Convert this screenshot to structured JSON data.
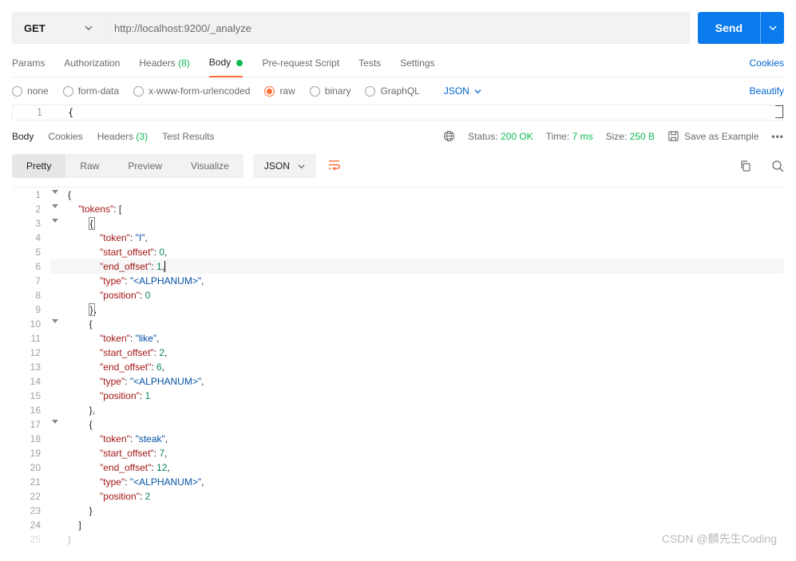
{
  "request": {
    "method": "GET",
    "url": "http://localhost:9200/_analyze",
    "sendLabel": "Send"
  },
  "reqTabs": {
    "params": "Params",
    "authorization": "Authorization",
    "headers": "Headers",
    "headersCount": "(8)",
    "body": "Body",
    "prerequest": "Pre-request Script",
    "tests": "Tests",
    "settings": "Settings",
    "cookies": "Cookies"
  },
  "bodyTypes": {
    "none": "none",
    "formdata": "form-data",
    "xwww": "x-www-form-urlencoded",
    "raw": "raw",
    "binary": "binary",
    "graphql": "GraphQL",
    "jsonLabel": "JSON",
    "beautify": "Beautify"
  },
  "inputEditor": {
    "line1": "1",
    "content": "{"
  },
  "respTabs": {
    "body": "Body",
    "cookies": "Cookies",
    "headers": "Headers",
    "headersCount": "(3)",
    "testresults": "Test Results"
  },
  "respMeta": {
    "statusLabel": "Status:",
    "statusVal": "200 OK",
    "timeLabel": "Time:",
    "timeVal": "7 ms",
    "sizeLabel": "Size:",
    "sizeVal": "250 B",
    "saveExample": "Save as Example"
  },
  "viewerSeg": {
    "pretty": "Pretty",
    "raw": "Raw",
    "preview": "Preview",
    "visualize": "Visualize",
    "json": "JSON"
  },
  "jsonLines": [
    {
      "n": 1,
      "indent": 0,
      "parts": [
        {
          "t": "punc",
          "v": "{"
        }
      ],
      "fold": true
    },
    {
      "n": 2,
      "indent": 1,
      "parts": [
        {
          "t": "key",
          "v": "\"tokens\""
        },
        {
          "t": "punc",
          "v": ": ["
        }
      ],
      "fold": true
    },
    {
      "n": 3,
      "indent": 2,
      "parts": [
        {
          "t": "box",
          "v": "{"
        }
      ],
      "fold": true
    },
    {
      "n": 4,
      "indent": 3,
      "parts": [
        {
          "t": "key",
          "v": "\"token\""
        },
        {
          "t": "punc",
          "v": ": "
        },
        {
          "t": "str",
          "v": "\"I\""
        },
        {
          "t": "punc",
          "v": ","
        }
      ]
    },
    {
      "n": 5,
      "indent": 3,
      "parts": [
        {
          "t": "key",
          "v": "\"start_offset\""
        },
        {
          "t": "punc",
          "v": ": "
        },
        {
          "t": "num",
          "v": "0"
        },
        {
          "t": "punc",
          "v": ","
        }
      ]
    },
    {
      "n": 6,
      "indent": 3,
      "parts": [
        {
          "t": "key",
          "v": "\"end_offset\""
        },
        {
          "t": "punc",
          "v": ": "
        },
        {
          "t": "num",
          "v": "1"
        },
        {
          "t": "punc",
          "v": ","
        }
      ],
      "highlight": true,
      "cursor": true
    },
    {
      "n": 7,
      "indent": 3,
      "parts": [
        {
          "t": "key",
          "v": "\"type\""
        },
        {
          "t": "punc",
          "v": ": "
        },
        {
          "t": "str",
          "v": "\"<ALPHANUM>\""
        },
        {
          "t": "punc",
          "v": ","
        }
      ]
    },
    {
      "n": 8,
      "indent": 3,
      "parts": [
        {
          "t": "key",
          "v": "\"position\""
        },
        {
          "t": "punc",
          "v": ": "
        },
        {
          "t": "num",
          "v": "0"
        }
      ]
    },
    {
      "n": 9,
      "indent": 2,
      "parts": [
        {
          "t": "box",
          "v": "}"
        },
        {
          "t": "punc",
          "v": ","
        }
      ]
    },
    {
      "n": 10,
      "indent": 2,
      "parts": [
        {
          "t": "punc",
          "v": "{"
        }
      ],
      "fold": true
    },
    {
      "n": 11,
      "indent": 3,
      "parts": [
        {
          "t": "key",
          "v": "\"token\""
        },
        {
          "t": "punc",
          "v": ": "
        },
        {
          "t": "str",
          "v": "\"like\""
        },
        {
          "t": "punc",
          "v": ","
        }
      ]
    },
    {
      "n": 12,
      "indent": 3,
      "parts": [
        {
          "t": "key",
          "v": "\"start_offset\""
        },
        {
          "t": "punc",
          "v": ": "
        },
        {
          "t": "num",
          "v": "2"
        },
        {
          "t": "punc",
          "v": ","
        }
      ]
    },
    {
      "n": 13,
      "indent": 3,
      "parts": [
        {
          "t": "key",
          "v": "\"end_offset\""
        },
        {
          "t": "punc",
          "v": ": "
        },
        {
          "t": "num",
          "v": "6"
        },
        {
          "t": "punc",
          "v": ","
        }
      ]
    },
    {
      "n": 14,
      "indent": 3,
      "parts": [
        {
          "t": "key",
          "v": "\"type\""
        },
        {
          "t": "punc",
          "v": ": "
        },
        {
          "t": "str",
          "v": "\"<ALPHANUM>\""
        },
        {
          "t": "punc",
          "v": ","
        }
      ]
    },
    {
      "n": 15,
      "indent": 3,
      "parts": [
        {
          "t": "key",
          "v": "\"position\""
        },
        {
          "t": "punc",
          "v": ": "
        },
        {
          "t": "num",
          "v": "1"
        }
      ]
    },
    {
      "n": 16,
      "indent": 2,
      "parts": [
        {
          "t": "punc",
          "v": "},"
        }
      ]
    },
    {
      "n": 17,
      "indent": 2,
      "parts": [
        {
          "t": "punc",
          "v": "{"
        }
      ],
      "fold": true
    },
    {
      "n": 18,
      "indent": 3,
      "parts": [
        {
          "t": "key",
          "v": "\"token\""
        },
        {
          "t": "punc",
          "v": ": "
        },
        {
          "t": "str",
          "v": "\"steak\""
        },
        {
          "t": "punc",
          "v": ","
        }
      ]
    },
    {
      "n": 19,
      "indent": 3,
      "parts": [
        {
          "t": "key",
          "v": "\"start_offset\""
        },
        {
          "t": "punc",
          "v": ": "
        },
        {
          "t": "num",
          "v": "7"
        },
        {
          "t": "punc",
          "v": ","
        }
      ]
    },
    {
      "n": 20,
      "indent": 3,
      "parts": [
        {
          "t": "key",
          "v": "\"end_offset\""
        },
        {
          "t": "punc",
          "v": ": "
        },
        {
          "t": "num",
          "v": "12"
        },
        {
          "t": "punc",
          "v": ","
        }
      ]
    },
    {
      "n": 21,
      "indent": 3,
      "parts": [
        {
          "t": "key",
          "v": "\"type\""
        },
        {
          "t": "punc",
          "v": ": "
        },
        {
          "t": "str",
          "v": "\"<ALPHANUM>\""
        },
        {
          "t": "punc",
          "v": ","
        }
      ]
    },
    {
      "n": 22,
      "indent": 3,
      "parts": [
        {
          "t": "key",
          "v": "\"position\""
        },
        {
          "t": "punc",
          "v": ": "
        },
        {
          "t": "num",
          "v": "2"
        }
      ]
    },
    {
      "n": 23,
      "indent": 2,
      "parts": [
        {
          "t": "punc",
          "v": "}"
        }
      ]
    },
    {
      "n": 24,
      "indent": 1,
      "parts": [
        {
          "t": "punc",
          "v": "]"
        }
      ]
    },
    {
      "n": 25,
      "indent": 0,
      "parts": [
        {
          "t": "punc",
          "v": "}"
        }
      ],
      "faint": true
    }
  ],
  "watermark": "CSDN @麟先生Coding"
}
